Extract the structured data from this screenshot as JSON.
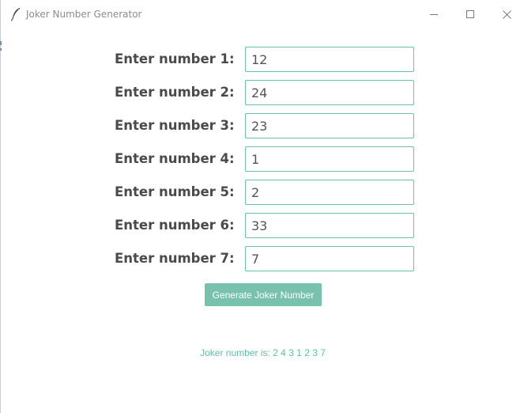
{
  "window": {
    "title": "Joker Number Generator",
    "icon": "feather-icon",
    "controls": {
      "minimize_icon": "minimize-icon",
      "maximize_icon": "maximize-icon",
      "close_icon": "close-icon"
    }
  },
  "form": {
    "fields": [
      {
        "label": "Enter number 1:",
        "value": "12"
      },
      {
        "label": "Enter number 2:",
        "value": "24"
      },
      {
        "label": "Enter number 3:",
        "value": "23"
      },
      {
        "label": "Enter number 4:",
        "value": "1"
      },
      {
        "label": "Enter number 5:",
        "value": "2"
      },
      {
        "label": "Enter number 6:",
        "value": "33"
      },
      {
        "label": "Enter number 7:",
        "value": "7"
      }
    ],
    "generate_label": "Generate Joker Number"
  },
  "result": {
    "prefix": "Joker number is:",
    "value": "2 4 3 1 2 3 7"
  },
  "colors": {
    "accent": "#78c2ad",
    "input_border": "#68c2a3",
    "result_text": "#5fc1a3",
    "label_text": "#4a4a4a",
    "title_text": "#8c8c8c"
  }
}
